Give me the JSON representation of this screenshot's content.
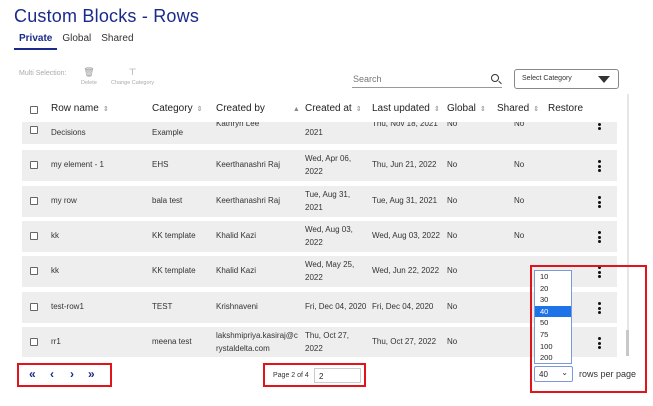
{
  "page": {
    "title": "Custom Blocks - Rows"
  },
  "tabs": [
    {
      "label": "Private",
      "active": true
    },
    {
      "label": "Global",
      "active": false
    },
    {
      "label": "Shared",
      "active": false
    }
  ],
  "toolbar": {
    "multi_selection_label": "Multi Selection:",
    "delete_label": "Delete",
    "change_category_label": "Change Category",
    "search_placeholder": "Search",
    "category_select_label": "Select Category"
  },
  "table": {
    "headers": [
      "Row name",
      "Category",
      "Created by",
      "Created at",
      "Last updated",
      "Global",
      "Shared",
      "Restore"
    ],
    "rows": [
      {
        "name": "Decisions",
        "name_top": "",
        "category": "Example",
        "created_by": "Kathryn Lee",
        "created_at_1": "2021",
        "created_at_2": "",
        "last_updated": "Thu, Nov 18, 2021",
        "global": "No",
        "shared": "No"
      },
      {
        "name": "my element - 1",
        "category": "EHS",
        "created_by": "Keerthanashri Raj",
        "created_at_1": "Wed, Apr 06,",
        "created_at_2": "2022",
        "last_updated": "Thu, Jun 21, 2022",
        "global": "No",
        "shared": "No"
      },
      {
        "name": "my row",
        "category": "bala test",
        "created_by": "Keerthanashri Raj",
        "created_at_1": "Tue, Aug 31,",
        "created_at_2": "2021",
        "last_updated": "Tue, Aug 31, 2021",
        "global": "No",
        "shared": "No"
      },
      {
        "name": "kk",
        "category": "KK template",
        "created_by": "Khalid Kazi",
        "created_at_1": "Wed, Aug 03,",
        "created_at_2": "2022",
        "last_updated": "Wed, Aug 03, 2022",
        "global": "No",
        "shared": "No"
      },
      {
        "name": "kk",
        "category": "KK template",
        "created_by": "Khalid Kazi",
        "created_at_1": "Wed, May 25,",
        "created_at_2": "2022",
        "last_updated": "Wed, Jun 22, 2022",
        "global": "No",
        "shared": ""
      },
      {
        "name": "test-row1",
        "category": "TEST",
        "created_by": "Krishnaveni",
        "created_at_1": "Fri, Dec 04, 2020",
        "created_at_2": "",
        "last_updated": "Fri, Dec 04, 2020",
        "global": "No",
        "shared": ""
      },
      {
        "name": "rr1",
        "category": "meena test",
        "created_by": "lakshmipriya.kasiraj@c",
        "created_by_2": "rystaldelta.com",
        "created_at_1": "Thu, Oct 27,",
        "created_at_2": "2022",
        "last_updated": "Thu, Oct 27, 2022",
        "global": "No",
        "shared": ""
      }
    ]
  },
  "pagination": {
    "page_label": "Page 2 of 4",
    "page_input": "2",
    "rows_per_page_value": "40",
    "rows_per_page_label": "rows per page",
    "options": [
      "10",
      "20",
      "30",
      "40",
      "50",
      "75",
      "100",
      "200"
    ],
    "selected_option": "40"
  },
  "colors": {
    "accent": "#1a2a8a",
    "highlight": "#e0141a",
    "selected": "#1e73e8"
  }
}
